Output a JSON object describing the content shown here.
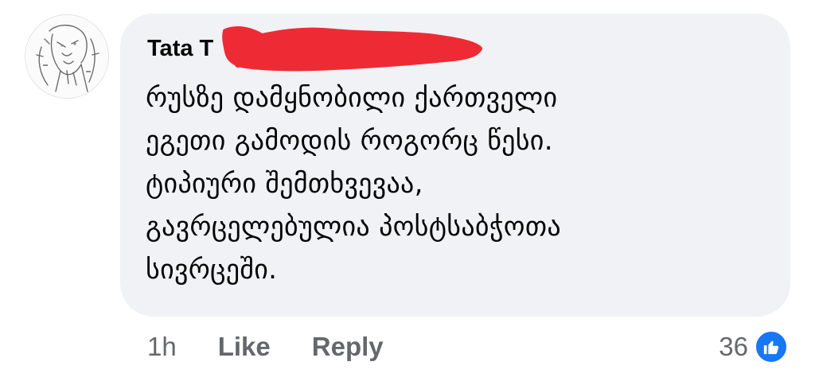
{
  "comment": {
    "author": "Tata T",
    "avatar_icon": "sketch-portrait-avatar",
    "redaction_color": "#ee2b35",
    "lines": [
      "რუსზე დამყნობილი ქართველი",
      "ეგეთი გამოდის როგორც წესი.",
      "ტიპიური შემთხვევაა,",
      "გავრცელებულია პოსტსაბჭოთა",
      "სივრცეში."
    ]
  },
  "actions": {
    "time": "1h",
    "like_label": "Like",
    "reply_label": "Reply"
  },
  "reactions": {
    "count": "36",
    "icon": "thumbs-up-icon",
    "badge_color": "#1877f2"
  }
}
